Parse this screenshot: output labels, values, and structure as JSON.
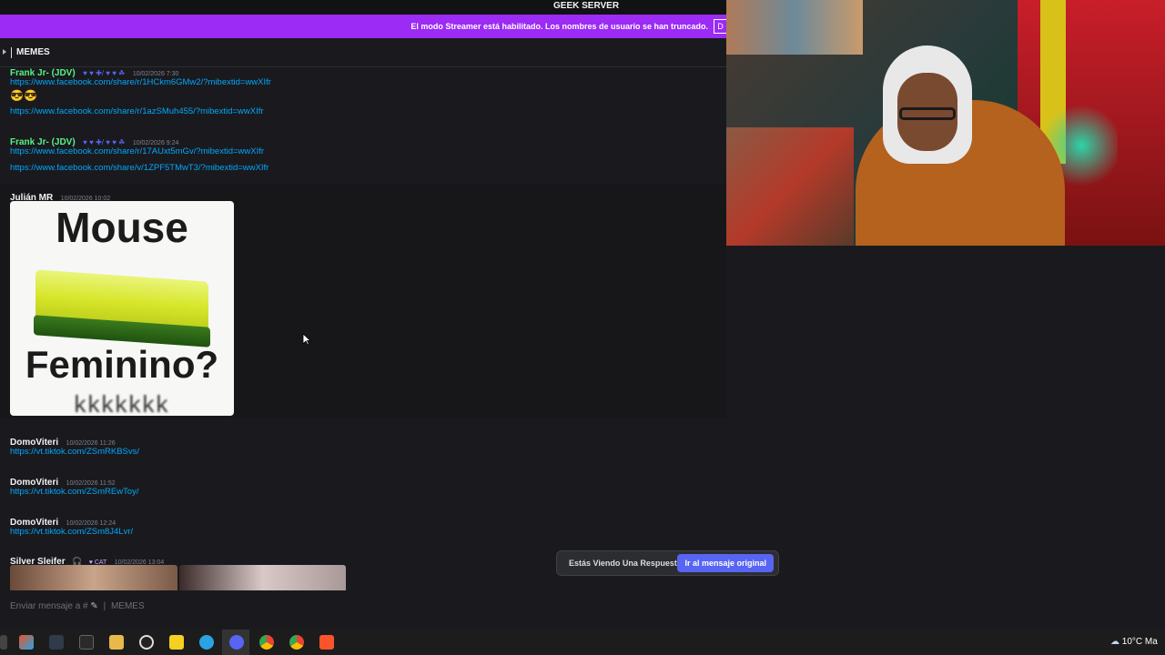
{
  "top_bar": {
    "server_name": "GEEK SERVER"
  },
  "streamer_banner": {
    "text": "El modo Streamer está habilitado. Los nombres de usuario se han truncado.",
    "button": "D"
  },
  "channel": {
    "name": "MEMES"
  },
  "messages": [
    {
      "author": "Frank Jr- (JDV)",
      "timestamp": "10/02/2026 7:30",
      "links": [
        "https://www.facebook.com/share/r/1HCkm6GMw2/?mibextid=wwXIfr",
        "https://www.facebook.com/share/r/1azSMuh455/?mibextid=wwXIfr"
      ],
      "emoji": "😎😎"
    },
    {
      "author": "Frank Jr- (JDV)",
      "timestamp": "10/02/2026 9:24",
      "links": [
        "https://www.facebook.com/share/r/17AUxt5mGv/?mibextid=wwXIfr",
        "https://www.facebook.com/share/v/1ZPF5TMwT3/?mibextid=wwXIfr"
      ]
    },
    {
      "author": "Julián MR",
      "timestamp": "10/02/2026 10:02",
      "image_text_top": "Mouse",
      "image_text_bottom": "Feminino?",
      "image_text_tail": "kkkkkkk"
    },
    {
      "author": "DomoViteri",
      "timestamp": "10/02/2026 11:26",
      "links": [
        "https://vt.tiktok.com/ZSmRKBSvs/"
      ]
    },
    {
      "author": "DomoViteri",
      "timestamp": "10/02/2026 11:52",
      "links": [
        "https://vt.tiktok.com/ZSmREwToy/"
      ]
    },
    {
      "author": "DomoViteri",
      "timestamp": "10/02/2026 12:24",
      "links": [
        "https://vt.tiktok.com/ZSm8J4Lvr/"
      ]
    },
    {
      "author": "Silver Sleifer",
      "badge": "CAT",
      "timestamp": "10/02/2026 13:04"
    }
  ],
  "composer": {
    "placeholder": "Enviar mensaje a #",
    "channel": "MEMES"
  },
  "reply_toast": {
    "text": "Estás Viendo Una Respuesta.",
    "button": "Ir al mensaje original"
  },
  "taskbar": {
    "weather": "10°C",
    "weather_suffix": "Ma"
  }
}
